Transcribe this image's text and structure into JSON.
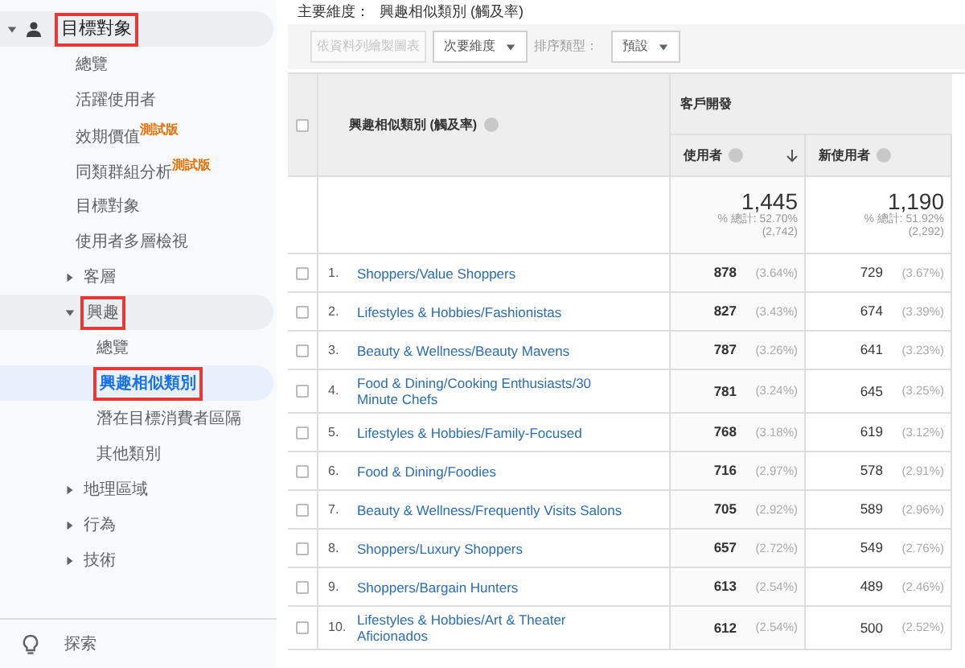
{
  "sidebar": {
    "items": [
      {
        "label": "目標對象",
        "kind": "group",
        "expanded": true,
        "highlighted": true,
        "selected": false,
        "children": [
          {
            "label": "總覽",
            "kind": "page",
            "highlighted": false,
            "selected": false
          },
          {
            "label": "活躍使用者",
            "kind": "page",
            "highlighted": false,
            "selected": false
          },
          {
            "label": "效期價值",
            "badge": "測試版",
            "kind": "page",
            "highlighted": false,
            "selected": false
          },
          {
            "label": "同類群組分析",
            "badge": "測試版",
            "kind": "page",
            "highlighted": false,
            "selected": false
          },
          {
            "label": "目標對象",
            "kind": "page",
            "highlighted": false,
            "selected": false
          },
          {
            "label": "使用者多層檢視",
            "kind": "page",
            "highlighted": false,
            "selected": false
          },
          {
            "label": "客層",
            "kind": "group",
            "expanded": false,
            "highlighted": false,
            "selected": false
          },
          {
            "label": "興趣",
            "kind": "group",
            "expanded": true,
            "highlighted": true,
            "selected": false,
            "children": [
              {
                "label": "總覽",
                "kind": "page",
                "highlighted": false,
                "selected": false
              },
              {
                "label": "興趣相似類別",
                "kind": "page",
                "highlighted": true,
                "selected": true
              },
              {
                "label": "潛在目標消費者區隔",
                "kind": "page",
                "highlighted": false,
                "selected": false
              },
              {
                "label": "其他類別",
                "kind": "page",
                "highlighted": false,
                "selected": false
              }
            ]
          },
          {
            "label": "地理區域",
            "kind": "group",
            "expanded": false,
            "highlighted": false,
            "selected": false
          },
          {
            "label": "行為",
            "kind": "group",
            "expanded": false,
            "highlighted": false,
            "selected": false
          },
          {
            "label": "技術",
            "kind": "group",
            "expanded": false,
            "highlighted": false,
            "selected": false
          }
        ]
      }
    ],
    "footer": {
      "label": "探索"
    }
  },
  "primary_dimension": {
    "label": "主要維度：",
    "value": "興趣相似類別 (觸及率)"
  },
  "toolbar": {
    "chart_button": {
      "label": "依資料列繪製圖表",
      "disabled": true
    },
    "secondary_dimension": "次要維度",
    "sort_label": "排序類型：",
    "sort_value": "預設"
  },
  "table": {
    "select_all_checked": false,
    "dimension_header": "興趣相似類別 (觸及率)",
    "group_header": "客戶開發",
    "columns": [
      {
        "label": "使用者",
        "sorted": true
      },
      {
        "label": "新使用者",
        "sorted": false
      }
    ],
    "summary": [
      {
        "value": "1,445",
        "share": "% 總計: 52.70%",
        "total": "(2,742)"
      },
      {
        "value": "1,190",
        "share": "% 總計: 51.92%",
        "total": "(2,292)"
      }
    ],
    "rows": [
      {
        "index": "1.",
        "name": "Shoppers/Value Shoppers",
        "checked": false,
        "cells": [
          {
            "value": "878",
            "pct": "(3.64%)"
          },
          {
            "value": "729",
            "pct": "(3.67%)"
          }
        ]
      },
      {
        "index": "2.",
        "name": "Lifestyles & Hobbies/Fashionistas",
        "checked": false,
        "cells": [
          {
            "value": "827",
            "pct": "(3.43%)"
          },
          {
            "value": "674",
            "pct": "(3.39%)"
          }
        ]
      },
      {
        "index": "3.",
        "name": "Beauty & Wellness/Beauty Mavens",
        "checked": false,
        "cells": [
          {
            "value": "787",
            "pct": "(3.26%)"
          },
          {
            "value": "641",
            "pct": "(3.23%)"
          }
        ]
      },
      {
        "index": "4.",
        "name": "Food & Dining/Cooking Enthusiasts/30 Minute Chefs",
        "checked": false,
        "cells": [
          {
            "value": "781",
            "pct": "(3.24%)"
          },
          {
            "value": "645",
            "pct": "(3.25%)"
          }
        ]
      },
      {
        "index": "5.",
        "name": "Lifestyles & Hobbies/Family-Focused",
        "checked": false,
        "cells": [
          {
            "value": "768",
            "pct": "(3.18%)"
          },
          {
            "value": "619",
            "pct": "(3.12%)"
          }
        ]
      },
      {
        "index": "6.",
        "name": "Food & Dining/Foodies",
        "checked": false,
        "cells": [
          {
            "value": "716",
            "pct": "(2.97%)"
          },
          {
            "value": "578",
            "pct": "(2.91%)"
          }
        ]
      },
      {
        "index": "7.",
        "name": "Beauty & Wellness/Frequently Visits Salons",
        "checked": false,
        "cells": [
          {
            "value": "705",
            "pct": "(2.92%)"
          },
          {
            "value": "589",
            "pct": "(2.96%)"
          }
        ]
      },
      {
        "index": "8.",
        "name": "Shoppers/Luxury Shoppers",
        "checked": false,
        "cells": [
          {
            "value": "657",
            "pct": "(2.72%)"
          },
          {
            "value": "549",
            "pct": "(2.76%)"
          }
        ]
      },
      {
        "index": "9.",
        "name": "Shoppers/Bargain Hunters",
        "checked": false,
        "cells": [
          {
            "value": "613",
            "pct": "(2.54%)"
          },
          {
            "value": "489",
            "pct": "(2.46%)"
          }
        ]
      },
      {
        "index": "10.",
        "name": "Lifestyles & Hobbies/Art & Theater Aficionados",
        "checked": false,
        "cells": [
          {
            "value": "612",
            "pct": "(2.54%)"
          },
          {
            "value": "500",
            "pct": "(2.52%)"
          }
        ]
      }
    ]
  }
}
